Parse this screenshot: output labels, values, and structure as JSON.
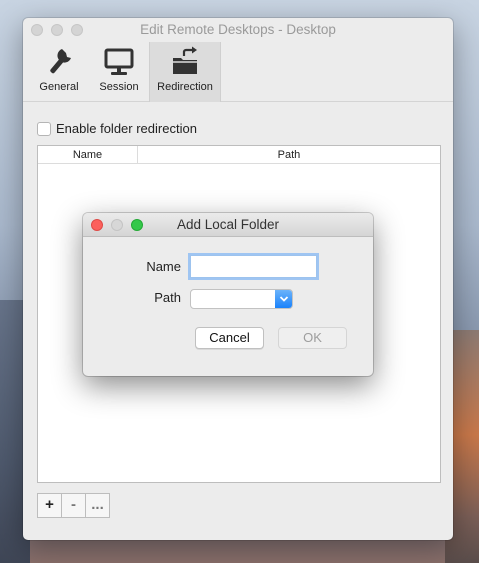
{
  "window": {
    "title": "Edit Remote Desktops - Desktop"
  },
  "toolbar": {
    "items": [
      {
        "label": "General",
        "icon": "wrench-icon"
      },
      {
        "label": "Session",
        "icon": "monitor-icon"
      },
      {
        "label": "Redirection",
        "icon": "folder-redirect-icon",
        "selected": true
      }
    ]
  },
  "redirection": {
    "enable_label": "Enable folder redirection",
    "enabled": false,
    "columns": [
      "Name",
      "Path"
    ],
    "buttons": {
      "add": "+",
      "remove": "-",
      "more": "..."
    }
  },
  "dialog": {
    "title": "Add Local Folder",
    "name_label": "Name",
    "name_value": "",
    "path_label": "Path",
    "path_value": "",
    "cancel_label": "Cancel",
    "ok_label": "OK"
  },
  "colors": {
    "accent": "#1a82fb",
    "focus_ring": "#9fc5f2",
    "close": "#fc605c",
    "zoom": "#34c84a"
  }
}
